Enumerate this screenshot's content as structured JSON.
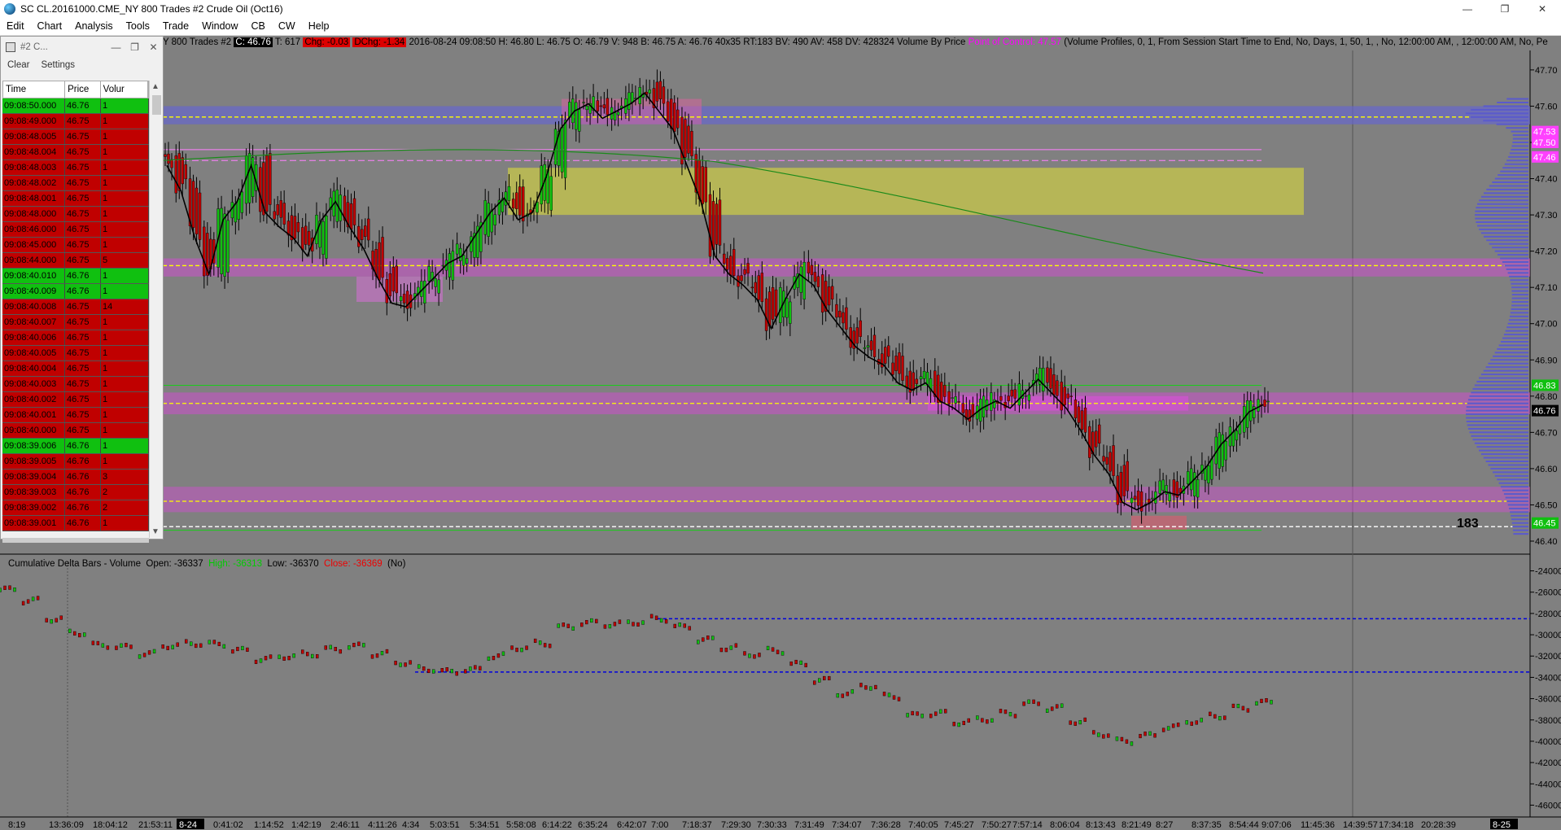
{
  "window": {
    "title": "SC CL.20161000.CME_NY  800 Trades  #2  Crude Oil (Oct16)",
    "min_icon": "—",
    "max_icon": "❐",
    "close_icon": "✕"
  },
  "menu": [
    "Edit",
    "Chart",
    "Analysis",
    "Tools",
    "Trade",
    "Window",
    "CB",
    "CW",
    "Help"
  ],
  "chart_header": {
    "prefix": "Y  800 Trades  #2",
    "close_badge": "C: 46.76",
    "ticks": "T: 617",
    "chg_badge": "Chg: -0.03",
    "dchg_badge": "DChg: -1.34",
    "details": "2016-08-24 09:08:50  H: 46.80  L: 46.75  O: 46.79  V: 948  B: 46.75  A: 46.76  40x35  RT:183  BV: 490  AV: 458  DV: 428324  Volume By Price",
    "poc": "Point of Control: 47.57",
    "vp_settings": "(Volume Profiles, 0, 1, From Session Start Time to End, No, Days, 1, 50, 1, , No, 12:00:00 AM, , 12:00:00 AM, No, Pe"
  },
  "price_axis": {
    "labels": [
      "47.70",
      "47.60",
      "47.50",
      "47.40",
      "47.30",
      "47.20",
      "47.10",
      "47.00",
      "46.90",
      "46.80",
      "46.70",
      "46.60",
      "46.50",
      "46.40"
    ],
    "tags": [
      {
        "text": "47.53",
        "color": "#ff40ff"
      },
      {
        "text": "47.50",
        "color": "#ff40ff"
      },
      {
        "text": "47.46",
        "color": "#ff40ff"
      },
      {
        "text": "46.83",
        "color": "#10c010"
      },
      {
        "text": "46.76",
        "color": "#000000"
      },
      {
        "text": "46.45",
        "color": "#10c010"
      }
    ],
    "bar_count": "183"
  },
  "delta_panel": {
    "title": "Cumulative Delta Bars - Volume",
    "open": "Open: -36337",
    "high": "High: -36313",
    "low": "Low: -36370",
    "close": "Close: -36369",
    "flag": "(No)",
    "axis_labels": [
      "-24000",
      "-26000",
      "-28000",
      "-30000",
      "-32000",
      "-34000",
      "-36000",
      "-38000",
      "-40000",
      "-42000",
      "-44000",
      "-46000"
    ]
  },
  "time_axis": {
    "labels": [
      "8:19",
      "13:36:09",
      "18:04:12",
      "21:53:11",
      "8-24",
      "0:41:02",
      "1:14:52",
      "1:42:19",
      "2:46:11",
      "4:11:26",
      "4:34",
      "5:03:51",
      "5:34:51",
      "5:58:08",
      "6:14:22",
      "6:35:24",
      "6:42:07",
      "7:00",
      "7:18:37",
      "7:29:30",
      "7:30:33",
      "7:31:49",
      "7:34:07",
      "7:36:28",
      "7:40:05",
      "7:45:27",
      "7:50:27",
      "7:57:14",
      "8:06:04",
      "8:13:43",
      "8:21:49",
      "8:27",
      "8:37:35",
      "8:54:44",
      "9:07:06",
      "11:45:36",
      "14:39:57",
      "17:34:18",
      "20:28:39",
      "8-25"
    ]
  },
  "time_sales": {
    "title": "#2 C...",
    "menu": [
      "Clear",
      "Settings"
    ],
    "columns": [
      "Time",
      "Price",
      "Volur"
    ],
    "rows": [
      {
        "time": "09:08:50.000",
        "price": "46.76",
        "vol": "1",
        "side": "buy"
      },
      {
        "time": "09:08:49.000",
        "price": "46.75",
        "vol": "1",
        "side": "sell"
      },
      {
        "time": "09:08:48.005",
        "price": "46.75",
        "vol": "1",
        "side": "sell"
      },
      {
        "time": "09:08:48.004",
        "price": "46.75",
        "vol": "1",
        "side": "sell"
      },
      {
        "time": "09:08:48.003",
        "price": "46.75",
        "vol": "1",
        "side": "sell"
      },
      {
        "time": "09:08:48.002",
        "price": "46.75",
        "vol": "1",
        "side": "sell"
      },
      {
        "time": "09:08:48.001",
        "price": "46.75",
        "vol": "1",
        "side": "sell"
      },
      {
        "time": "09:08:48.000",
        "price": "46.75",
        "vol": "1",
        "side": "sell"
      },
      {
        "time": "09:08:46.000",
        "price": "46.75",
        "vol": "1",
        "side": "sell"
      },
      {
        "time": "09:08:45.000",
        "price": "46.75",
        "vol": "1",
        "side": "sell"
      },
      {
        "time": "09:08:44.000",
        "price": "46.75",
        "vol": "5",
        "side": "sell"
      },
      {
        "time": "09:08:40.010",
        "price": "46.76",
        "vol": "1",
        "side": "buy"
      },
      {
        "time": "09:08:40.009",
        "price": "46.76",
        "vol": "1",
        "side": "buy"
      },
      {
        "time": "09:08:40.008",
        "price": "46.75",
        "vol": "14",
        "side": "sell"
      },
      {
        "time": "09:08:40.007",
        "price": "46.75",
        "vol": "1",
        "side": "sell"
      },
      {
        "time": "09:08:40.006",
        "price": "46.75",
        "vol": "1",
        "side": "sell"
      },
      {
        "time": "09:08:40.005",
        "price": "46.75",
        "vol": "1",
        "side": "sell"
      },
      {
        "time": "09:08:40.004",
        "price": "46.75",
        "vol": "1",
        "side": "sell"
      },
      {
        "time": "09:08:40.003",
        "price": "46.75",
        "vol": "1",
        "side": "sell"
      },
      {
        "time": "09:08:40.002",
        "price": "46.75",
        "vol": "1",
        "side": "sell"
      },
      {
        "time": "09:08:40.001",
        "price": "46.75",
        "vol": "1",
        "side": "sell"
      },
      {
        "time": "09:08:40.000",
        "price": "46.75",
        "vol": "1",
        "side": "sell"
      },
      {
        "time": "09:08:39.006",
        "price": "46.76",
        "vol": "1",
        "side": "buy"
      },
      {
        "time": "09:08:39.005",
        "price": "46.76",
        "vol": "1",
        "side": "sell"
      },
      {
        "time": "09:08:39.004",
        "price": "46.76",
        "vol": "3",
        "side": "sell"
      },
      {
        "time": "09:08:39.003",
        "price": "46.76",
        "vol": "2",
        "side": "sell"
      },
      {
        "time": "09:08:39.002",
        "price": "46.76",
        "vol": "2",
        "side": "sell"
      },
      {
        "time": "09:08:39.001",
        "price": "46.76",
        "vol": "1",
        "side": "sell"
      }
    ]
  },
  "colors": {
    "background": "#808080",
    "buy": "#10c010",
    "sell": "#c00000",
    "poc_line": "#ff40ff",
    "sma_black": "#000000",
    "sma_green": "#1a8a1a",
    "level_yellow": "#ffff00"
  },
  "chart_data": {
    "type": "candlestick",
    "price_range": [
      46.4,
      47.72
    ],
    "delta_range": [
      -46500,
      -23500
    ],
    "horizontal_levels": [
      47.57,
      47.16,
      46.78,
      46.51,
      46.44
    ],
    "series": [
      {
        "name": "price_path",
        "values": [
          47.45,
          47.38,
          47.25,
          47.15,
          47.3,
          47.35,
          47.45,
          47.32,
          47.28,
          47.25,
          47.2,
          47.3,
          47.35,
          47.28,
          47.22,
          47.14,
          47.07,
          47.06,
          47.1,
          47.14,
          47.18,
          47.2,
          47.26,
          47.32,
          47.36,
          47.3,
          47.32,
          47.42,
          47.55,
          47.6,
          47.62,
          47.58,
          47.6,
          47.62,
          47.65,
          47.6,
          47.55,
          47.45,
          47.35,
          47.2,
          47.15,
          47.12,
          47.08,
          47.0,
          47.08,
          47.15,
          47.12,
          47.05,
          47.0,
          46.95,
          46.92,
          46.9,
          46.85,
          46.83,
          46.85,
          46.8,
          46.78,
          46.75,
          46.78,
          46.8,
          46.78,
          46.82,
          46.86,
          46.82,
          46.78,
          46.72,
          46.65,
          46.6,
          46.52,
          46.5,
          46.52,
          46.55,
          46.54,
          46.58,
          46.62,
          46.68,
          46.72,
          46.77,
          46.79
        ]
      }
    ],
    "delta_series": [
      -25800,
      -26800,
      -28500,
      -29800,
      -31000,
      -31200,
      -31800,
      -31000,
      -30800,
      -30900,
      -31500,
      -32300,
      -32000,
      -31800,
      -31400,
      -31100,
      -31800,
      -32600,
      -33200,
      -33500,
      -33300,
      -32000,
      -31200,
      -30800,
      -29300,
      -28900,
      -29000,
      -28800,
      -28500,
      -29300,
      -30500,
      -31200,
      -31800,
      -31500,
      -32800,
      -34300,
      -35500,
      -34800,
      -35800,
      -37600,
      -37400,
      -38200,
      -37900,
      -37400,
      -36500,
      -36900,
      -38100,
      -39300,
      -40000,
      -39500,
      -38700,
      -38100,
      -37600,
      -36900,
      -36400
    ]
  }
}
